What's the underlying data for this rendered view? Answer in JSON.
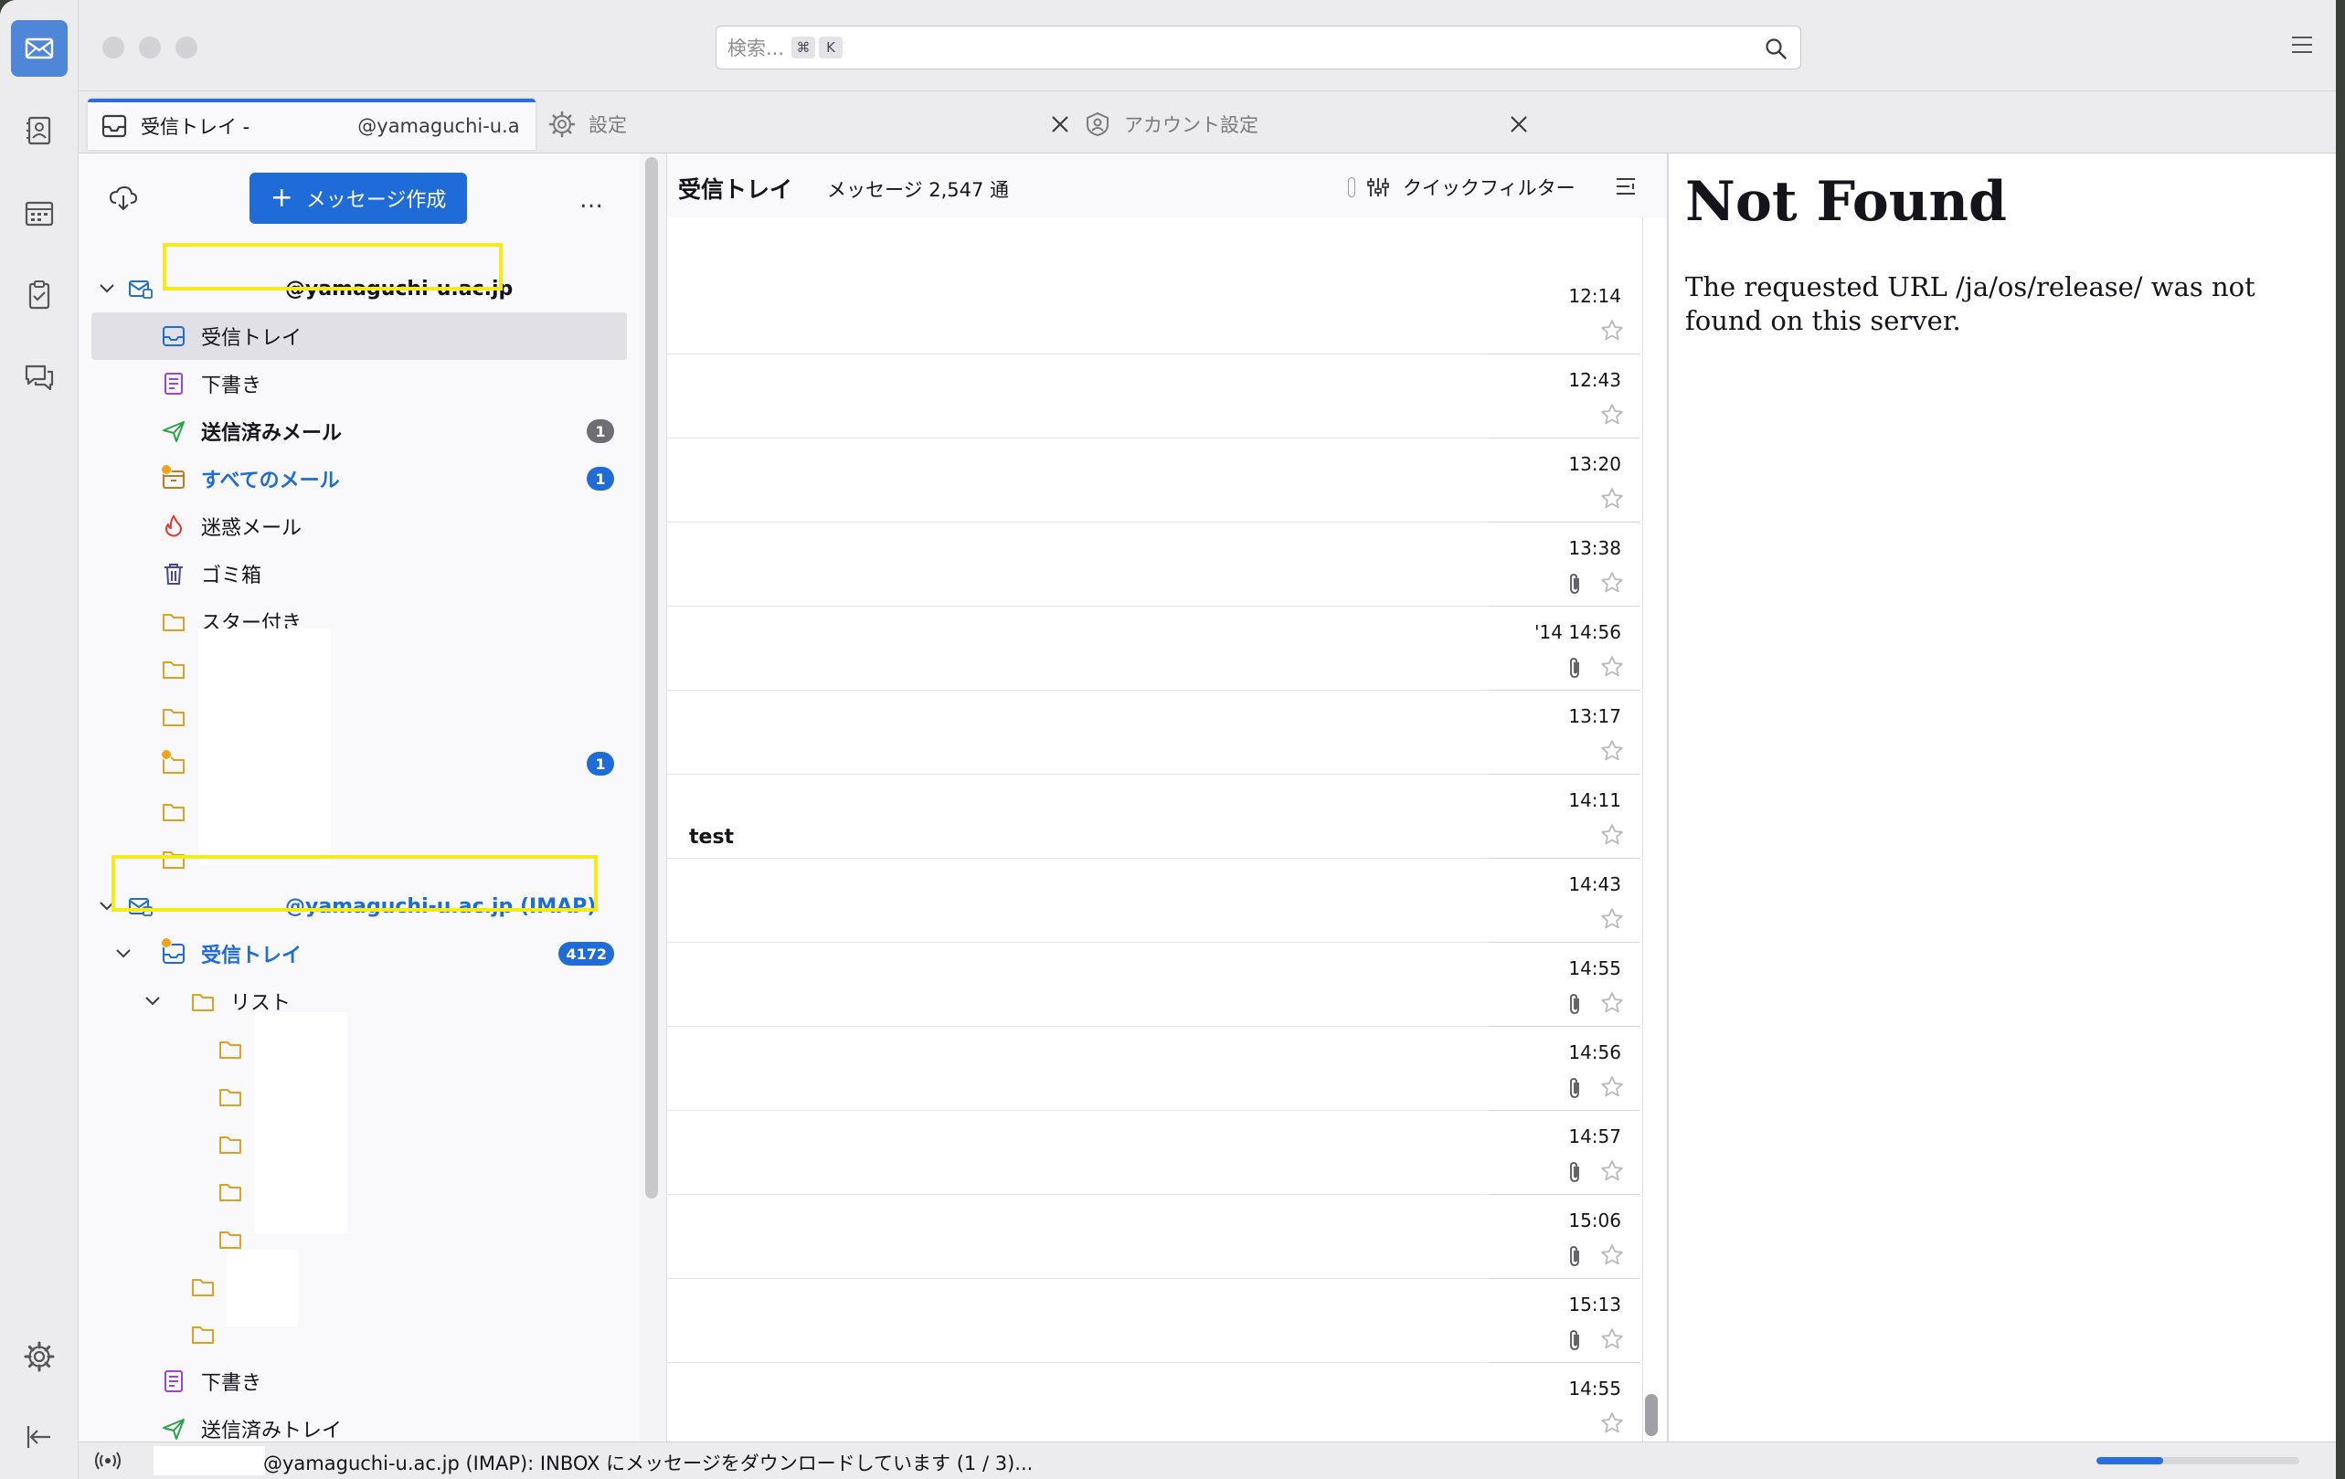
{
  "search": {
    "placeholder": "検索...",
    "shortcut_cmd": "⌘",
    "shortcut_key": "K"
  },
  "tabs": [
    {
      "label_prefix": "受信トレイ -",
      "label_suffix": "@yamaguchi-u.a"
    },
    {
      "label": "設定"
    },
    {
      "label": "アカウント設定"
    }
  ],
  "folder_pane": {
    "compose_label": "メッセージ作成",
    "more_label": "…",
    "account1": {
      "label": "@yamaguchi-u.ac.jp"
    },
    "account1_folders": [
      {
        "label": "受信トレイ"
      },
      {
        "label": "下書き"
      },
      {
        "label": "送信済みメール",
        "badge": "1"
      },
      {
        "label": "すべてのメール",
        "badge": "1"
      },
      {
        "label": "迷惑メール"
      },
      {
        "label": "ゴミ箱"
      },
      {
        "label": "スター付き"
      }
    ],
    "redacted_folder_badge": "1",
    "account2": {
      "label": "@yamaguchi-u.ac.jp (IMAP)"
    },
    "account2_folders": [
      {
        "label": "受信トレイ",
        "badge": "4172"
      },
      {
        "label": "リスト"
      },
      {
        "label": "下書き"
      },
      {
        "label": "送信済みトレイ"
      }
    ]
  },
  "thread_pane": {
    "title": "受信トレイ",
    "count": "メッセージ 2,547 通",
    "quick_filter": "クイックフィルター",
    "messages": [
      {
        "date": "12:14",
        "attachment": false,
        "subject": ""
      },
      {
        "date": "12:43",
        "attachment": false,
        "subject": ""
      },
      {
        "date": "13:20",
        "attachment": false,
        "subject": ""
      },
      {
        "date": "13:38",
        "attachment": true,
        "subject": ""
      },
      {
        "date": "'14 14:56",
        "attachment": true,
        "subject": ""
      },
      {
        "date": "13:17",
        "attachment": false,
        "subject": ""
      },
      {
        "date": "14:11",
        "attachment": false,
        "subject": "test"
      },
      {
        "date": "14:43",
        "attachment": false,
        "subject": ""
      },
      {
        "date": "14:55",
        "attachment": true,
        "subject": ""
      },
      {
        "date": "14:56",
        "attachment": true,
        "subject": ""
      },
      {
        "date": "14:57",
        "attachment": true,
        "subject": ""
      },
      {
        "date": "15:06",
        "attachment": true,
        "subject": ""
      },
      {
        "date": "15:13",
        "attachment": true,
        "subject": ""
      },
      {
        "date": "14:55",
        "attachment": false,
        "subject": ""
      }
    ]
  },
  "message_pane": {
    "heading": "Not Found",
    "body": "The requested URL /ja/os/release/ was not found on this server."
  },
  "status_bar": {
    "text": "@yamaguchi-u.ac.jp (IMAP): INBOX にメッセージをダウンロードしています (1 / 3)...",
    "progress": 0.33
  },
  "colors": {
    "accent": "#1f6bd8",
    "highlight": "#f5ec16",
    "new_dot": "#f3a21d"
  }
}
